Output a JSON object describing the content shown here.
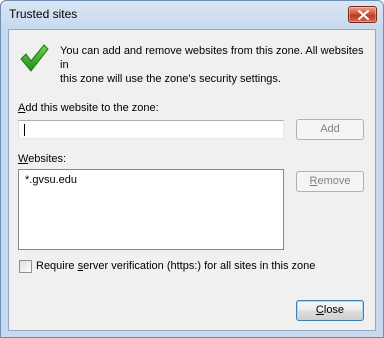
{
  "window": {
    "title": "Trusted sites"
  },
  "icons": {
    "check": "check-icon",
    "close": "close-icon"
  },
  "info": {
    "message_line1": "You can add and remove websites from this zone. All websites in",
    "message_line2": "this zone will use the zone's security settings."
  },
  "add": {
    "label_hotkey": "A",
    "label_rest": "dd this website to the zone:",
    "input_value": "",
    "button_label": "Add",
    "button_enabled": false
  },
  "websites": {
    "label_hotkey": "W",
    "label_rest": "ebsites:",
    "items": [
      "*.gvsu.edu"
    ],
    "remove_hotkey": "R",
    "remove_rest": "emove",
    "remove_enabled": false
  },
  "verification": {
    "label_prefix": "Require ",
    "label_hotkey": "s",
    "label_rest": "erver verification (https:) for all sites in this zone",
    "checked": false
  },
  "footer": {
    "close_hotkey": "C",
    "close_rest": "lose"
  },
  "colors": {
    "check_green": "#2fa51e",
    "dialog_background": "#f0f0f0",
    "title_gradient_top": "#d9e6f4",
    "close_red": "#c0391f"
  }
}
